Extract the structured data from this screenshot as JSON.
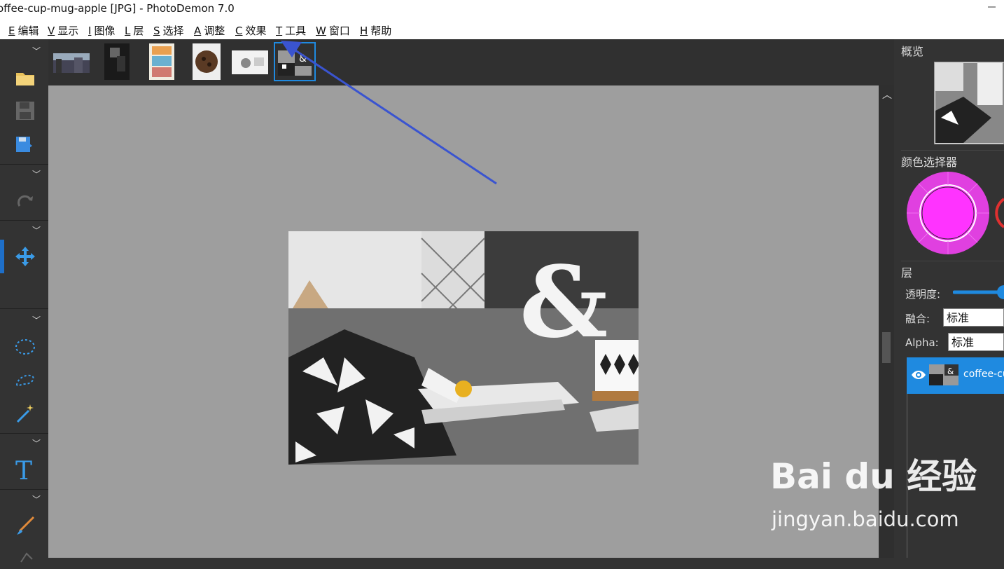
{
  "window": {
    "title": "offee-cup-mug-apple [JPG]  -  PhotoDemon 7.0"
  },
  "menu": [
    {
      "key": "E",
      "label": "编辑"
    },
    {
      "key": "V",
      "label": "显示"
    },
    {
      "key": "I",
      "label": "图像"
    },
    {
      "key": "L",
      "label": "层"
    },
    {
      "key": "S",
      "label": "选择"
    },
    {
      "key": "A",
      "label": "调整"
    },
    {
      "key": "C",
      "label": "效果"
    },
    {
      "key": "T",
      "label": "工具"
    },
    {
      "key": "W",
      "label": "窗口"
    },
    {
      "key": "H",
      "label": "帮助"
    }
  ],
  "right_panel": {
    "overview_title": "概览",
    "color_picker_title": "颜色选择器",
    "layers_title": "层",
    "opacity_label": "透明度:",
    "blend_label": "融合:",
    "blend_value": "标准",
    "alpha_label": "Alpha:",
    "alpha_value": "标准",
    "layer_name": "coffee-cu"
  },
  "colors": {
    "accent": "#1f8ae0",
    "primary_color": "#ff33ff",
    "canvas_bg": "#9e9e9e",
    "panel_bg": "#333333"
  },
  "watermark": {
    "brand": "Bai du 经验",
    "url": "jingyan.baidu.com"
  },
  "icons": [
    "open-folder-icon",
    "save-icon",
    "save-as-icon",
    "redo-icon",
    "move-icon",
    "ellipse-select-icon",
    "lasso-select-icon",
    "magic-wand-icon",
    "text-tool-icon",
    "paintbrush-icon",
    "eye-icon",
    "chevron-up-icon"
  ]
}
